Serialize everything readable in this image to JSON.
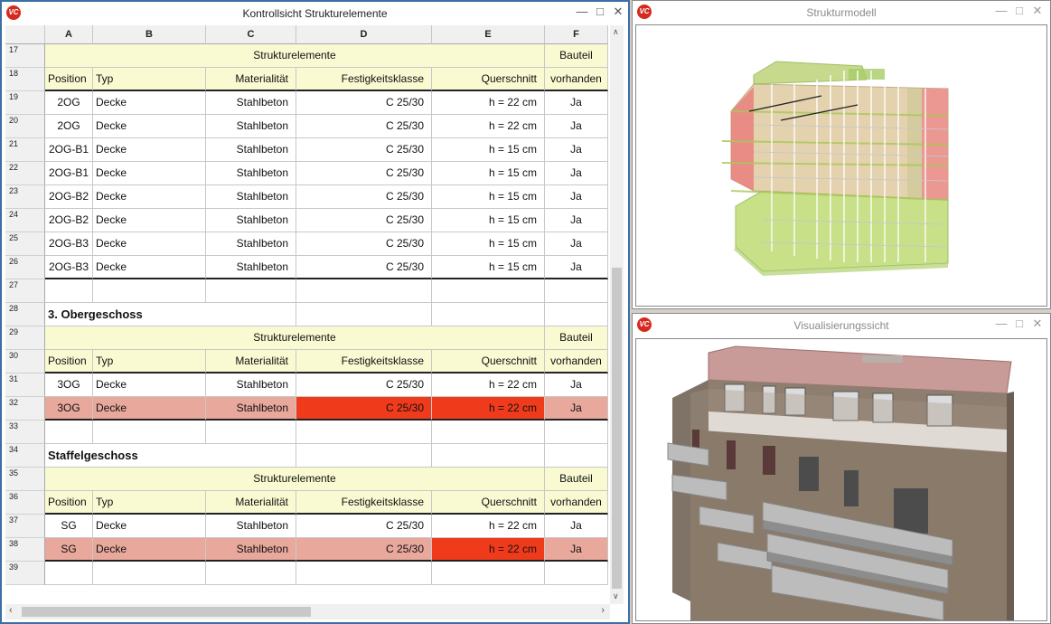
{
  "sheet_window": {
    "title": "Kontrollsicht Strukturelemente"
  },
  "model_window": {
    "title": "Strukturmodell"
  },
  "viz_window": {
    "title": "Visualisierungssicht"
  },
  "app_icon_label": "VC",
  "columns": [
    "A",
    "B",
    "C",
    "D",
    "E",
    "F"
  ],
  "rows": [
    {
      "num": "17",
      "kind": "group",
      "group": "Strukturelemente",
      "bauteil": "Bauteil"
    },
    {
      "num": "18",
      "kind": "header",
      "cells": [
        "Position",
        "Typ",
        "Materialität",
        "Festigkeitsklasse",
        "Querschnitt",
        "vorhanden"
      ]
    },
    {
      "num": "19",
      "kind": "data",
      "cells": [
        "2OG",
        "Decke",
        "Stahlbeton",
        "C 25/30",
        "h = 22 cm",
        "Ja"
      ]
    },
    {
      "num": "20",
      "kind": "data",
      "cells": [
        "2OG",
        "Decke",
        "Stahlbeton",
        "C 25/30",
        "h = 22 cm",
        "Ja"
      ]
    },
    {
      "num": "21",
      "kind": "data",
      "cells": [
        "2OG-B1",
        "Decke",
        "Stahlbeton",
        "C 25/30",
        "h = 15 cm",
        "Ja"
      ]
    },
    {
      "num": "22",
      "kind": "data",
      "cells": [
        "2OG-B1",
        "Decke",
        "Stahlbeton",
        "C 25/30",
        "h = 15 cm",
        "Ja"
      ]
    },
    {
      "num": "23",
      "kind": "data",
      "cells": [
        "2OG-B2",
        "Decke",
        "Stahlbeton",
        "C 25/30",
        "h = 15 cm",
        "Ja"
      ]
    },
    {
      "num": "24",
      "kind": "data",
      "cells": [
        "2OG-B2",
        "Decke",
        "Stahlbeton",
        "C 25/30",
        "h = 15 cm",
        "Ja"
      ]
    },
    {
      "num": "25",
      "kind": "data",
      "cells": [
        "2OG-B3",
        "Decke",
        "Stahlbeton",
        "C 25/30",
        "h = 15 cm",
        "Ja"
      ]
    },
    {
      "num": "26",
      "kind": "data",
      "last": true,
      "cells": [
        "2OG-B3",
        "Decke",
        "Stahlbeton",
        "C 25/30",
        "h = 15 cm",
        "Ja"
      ]
    },
    {
      "num": "27",
      "kind": "empty"
    },
    {
      "num": "28",
      "kind": "section",
      "label": "3. Obergeschoss"
    },
    {
      "num": "29",
      "kind": "group",
      "group": "Strukturelemente",
      "bauteil": "Bauteil"
    },
    {
      "num": "30",
      "kind": "header",
      "cells": [
        "Position",
        "Typ",
        "Materialität",
        "Festigkeitsklasse",
        "Querschnitt",
        "vorhanden"
      ]
    },
    {
      "num": "31",
      "kind": "data",
      "cells": [
        "3OG",
        "Decke",
        "Stahlbeton",
        "C 25/30",
        "h = 22 cm",
        "Ja"
      ]
    },
    {
      "num": "32",
      "kind": "data",
      "last": true,
      "highlight": "pink",
      "red": [
        3,
        4
      ],
      "cells": [
        "3OG",
        "Decke",
        "Stahlbeton",
        "C 25/30",
        "h = 22 cm",
        "Ja"
      ]
    },
    {
      "num": "33",
      "kind": "empty"
    },
    {
      "num": "34",
      "kind": "section",
      "label": "Staffelgeschoss"
    },
    {
      "num": "35",
      "kind": "group",
      "group": "Strukturelemente",
      "bauteil": "Bauteil"
    },
    {
      "num": "36",
      "kind": "header",
      "cells": [
        "Position",
        "Typ",
        "Materialität",
        "Festigkeitsklasse",
        "Querschnitt",
        "vorhanden"
      ]
    },
    {
      "num": "37",
      "kind": "data",
      "cells": [
        "SG",
        "Decke",
        "Stahlbeton",
        "C 25/30",
        "h = 22 cm",
        "Ja"
      ]
    },
    {
      "num": "38",
      "kind": "data",
      "last": true,
      "highlight": "pink",
      "red": [
        4
      ],
      "cells": [
        "SG",
        "Decke",
        "Stahlbeton",
        "C 25/30",
        "h = 22 cm",
        "Ja"
      ]
    },
    {
      "num": "39",
      "kind": "empty"
    }
  ],
  "colors": {
    "yellow": "#fafad2",
    "pink": "#e8a89c",
    "red": "#ef3b1c"
  }
}
